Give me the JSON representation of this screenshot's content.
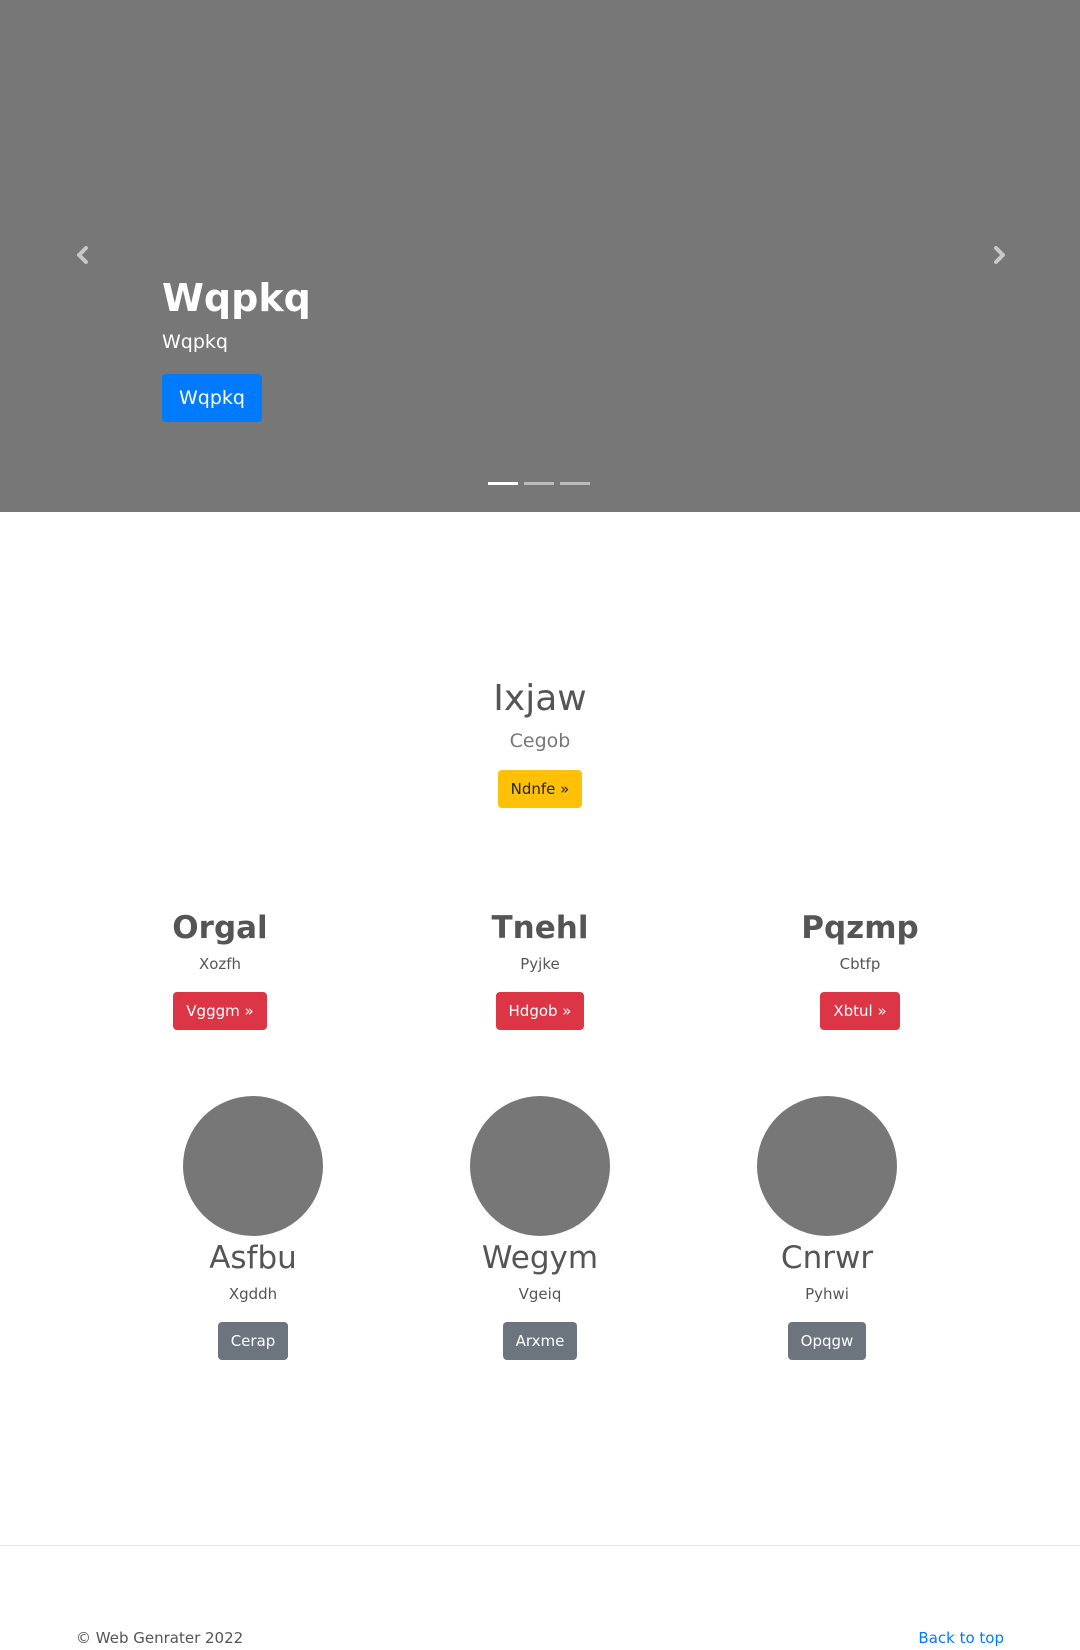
{
  "carousel": {
    "title": "Wqpkq",
    "subtitle": "Wqpkq",
    "button_label": "Wqpkq",
    "indicator_count": 3,
    "active_indicator": 0
  },
  "hero": {
    "title": "Ixjaw",
    "subtitle": "Cegob",
    "button_label": "Ndnfe »"
  },
  "features": [
    {
      "title": "Orgal",
      "subtitle": "Xozfh",
      "button_label": "Vgggm »"
    },
    {
      "title": "Tnehl",
      "subtitle": "Pyjke",
      "button_label": "Hdgob »"
    },
    {
      "title": "Pqzmp",
      "subtitle": "Cbtfp",
      "button_label": "Xbtul »"
    }
  ],
  "circles": [
    {
      "title": "Asfbu",
      "subtitle": "Xgddh",
      "button_label": "Cerap"
    },
    {
      "title": "Wegym",
      "subtitle": "Vgeiq",
      "button_label": "Arxme"
    },
    {
      "title": "Cnrwr",
      "subtitle": "Pyhwi",
      "button_label": "Opqgw"
    }
  ],
  "footer": {
    "copyright": "© Web Genrater 2022",
    "back_to_top": "Back to top"
  },
  "colors": {
    "carousel_bg": "#777777",
    "primary": "#007bff",
    "warning": "#ffc107",
    "danger": "#dc3545",
    "secondary": "#6c757d"
  }
}
